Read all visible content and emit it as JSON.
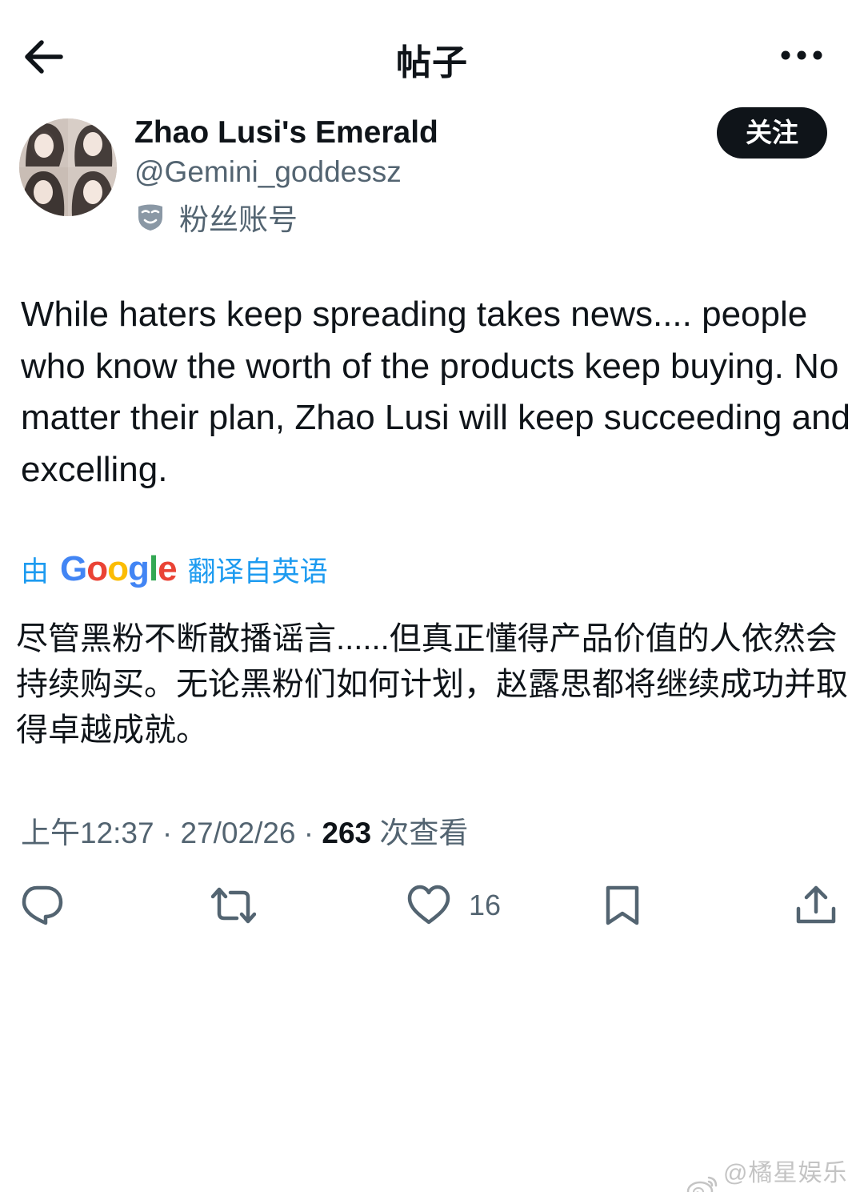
{
  "header": {
    "title": "帖子",
    "back_icon": "arrow-left-icon",
    "more_icon": "more-horizontal-icon"
  },
  "author": {
    "display_name": "Zhao Lusi's Emerald",
    "handle": "@Gemini_goddessz",
    "account_type_icon": "mask-icon",
    "account_type": "粉丝账号",
    "follow_label": "关注"
  },
  "post": {
    "text": "While haters keep spreading takes news.... people who know the worth of the products keep buying. No matter their plan, Zhao Lusi will keep succeeding and excelling.",
    "translation": {
      "by": "由",
      "provider": "Google",
      "translated_from": "翻译自英语",
      "text": "尽管黑粉不断散播谣言......但真正懂得产品价值的人依然会持续购买。无论黑粉们如何计划，赵露思都将继续成功并取得卓越成就。"
    }
  },
  "meta": {
    "time": "上午12:37",
    "separator": "·",
    "date": "27/02/26",
    "views_count": "263",
    "views_label": "次查看"
  },
  "actions": {
    "reply_icon": "reply-icon",
    "repost_icon": "repost-icon",
    "like_icon": "heart-icon",
    "like_count": "16",
    "bookmark_icon": "bookmark-icon",
    "share_icon": "share-icon"
  },
  "watermark": {
    "icon": "weibo-icon",
    "text": "@橘星娱乐馆"
  },
  "colors": {
    "text_primary": "#0f1419",
    "text_secondary": "#536471",
    "link_blue": "#1d9bf0",
    "follow_bg": "#0f1419",
    "google_blue": "#4285f4",
    "google_red": "#ea4335",
    "google_yellow": "#fbbc05",
    "google_green": "#34a853"
  }
}
